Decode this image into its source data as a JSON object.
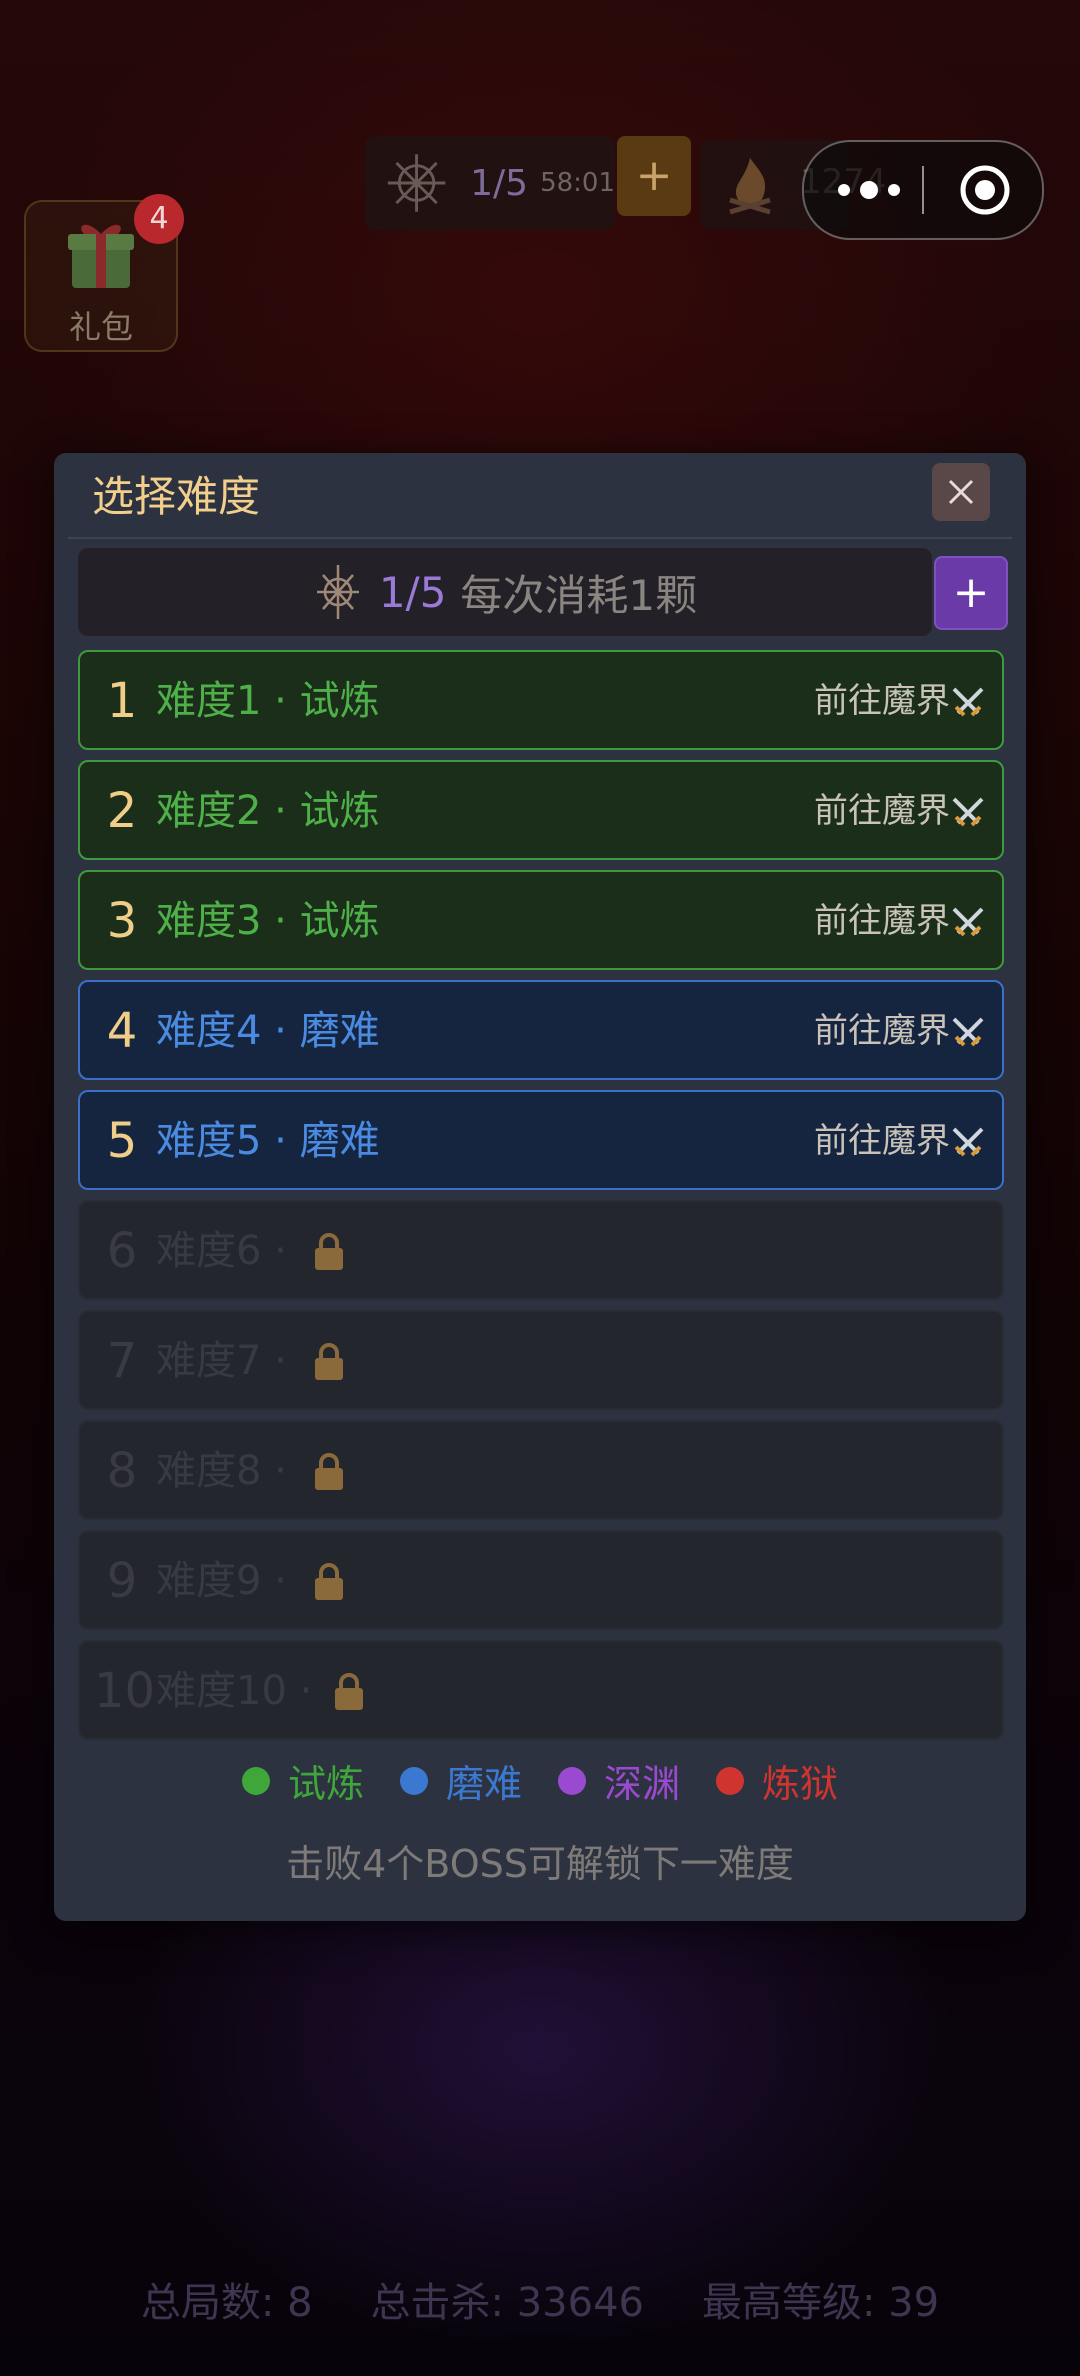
{
  "hud": {
    "resource_count": "1/5",
    "timer": "58:01",
    "plus_label": "+",
    "fire_count": "1274"
  },
  "gift": {
    "label": "礼包",
    "badge": "4"
  },
  "stats": {
    "total_games": "总局数: 8",
    "total_kills": "总击杀: 33646",
    "max_level": "最高等级: 39"
  },
  "modal": {
    "title": "选择难度",
    "cost_count": "1/5",
    "cost_desc": "每次消耗1颗",
    "cost_plus": "+",
    "go_label": "前往魔界",
    "levels": [
      {
        "num": "1",
        "name": "难度1 · 试炼"
      },
      {
        "num": "2",
        "name": "难度2 · 试炼"
      },
      {
        "num": "3",
        "name": "难度3 · 试炼"
      },
      {
        "num": "4",
        "name": "难度4 · 磨难"
      },
      {
        "num": "5",
        "name": "难度5 · 磨难"
      },
      {
        "num": "6",
        "name": "难度6 ·"
      },
      {
        "num": "7",
        "name": "难度7 ·"
      },
      {
        "num": "8",
        "name": "难度8 ·"
      },
      {
        "num": "9",
        "name": "难度9 ·"
      },
      {
        "num": "10",
        "name": "难度10 ·"
      }
    ],
    "legend": [
      {
        "label": "试炼",
        "color": "#3fa63a"
      },
      {
        "label": "磨难",
        "color": "#3b78d0"
      },
      {
        "label": "深渊",
        "color": "#9a4ad0"
      },
      {
        "label": "炼狱",
        "color": "#d0342e"
      }
    ],
    "note": "击败4个BOSS可解锁下一难度"
  },
  "colors": {
    "title": "#f2cf8c",
    "trial": "#3fa63a",
    "ordeal": "#3b78d0"
  }
}
